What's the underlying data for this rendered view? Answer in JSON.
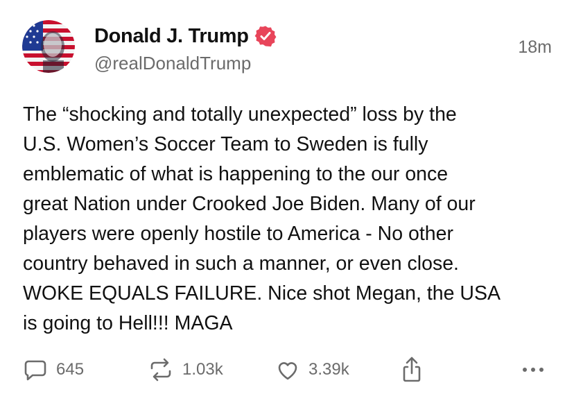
{
  "post": {
    "author": {
      "display_name": "Donald J. Trump",
      "handle": "@realDonaldTrump",
      "verified": true,
      "verified_badge_color": "#e8455a",
      "avatar_icon": "avatar-icon"
    },
    "timestamp": "18m",
    "text": "The “shocking and totally unexpected” loss by the\nU.S. Women’s Soccer Team to Sweden is fully\nemblematic of what is happening to the our once\ngreat Nation under Crooked Joe Biden. Many of our\nplayers were openly hostile to America - No other\ncountry behaved in such a manner, or even close.\nWOKE EQUALS FAILURE. Nice shot Megan, the USA\nis going to Hell!!! MAGA",
    "stats": {
      "replies": "645",
      "reposts": "1.03k",
      "likes": "3.39k"
    },
    "action_icons": [
      "reply-icon",
      "repost-icon",
      "like-icon",
      "share-icon",
      "more-icon"
    ],
    "colors": {
      "text": "#111111",
      "muted": "#6b6b6b",
      "background": "#ffffff"
    }
  }
}
